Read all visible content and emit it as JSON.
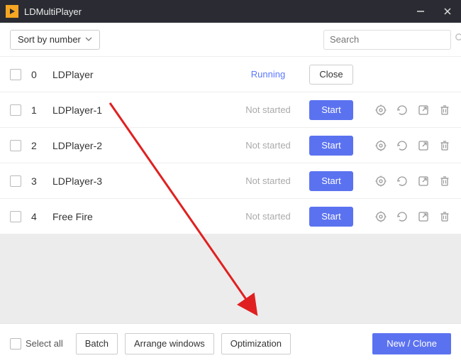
{
  "window": {
    "title": "LDMultiPlayer"
  },
  "toolbar": {
    "sort_label": "Sort by number",
    "search_placeholder": "Search"
  },
  "status_labels": {
    "running": "Running",
    "not_started": "Not started"
  },
  "action_labels": {
    "start": "Start",
    "close": "Close"
  },
  "instances": [
    {
      "index": "0",
      "name": "LDPlayer",
      "status": "running",
      "action": "close",
      "show_icons": false
    },
    {
      "index": "1",
      "name": "LDPlayer-1",
      "status": "not_started",
      "action": "start",
      "show_icons": true
    },
    {
      "index": "2",
      "name": "LDPlayer-2",
      "status": "not_started",
      "action": "start",
      "show_icons": true
    },
    {
      "index": "3",
      "name": "LDPlayer-3",
      "status": "not_started",
      "action": "start",
      "show_icons": true
    },
    {
      "index": "4",
      "name": "Free Fire",
      "status": "not_started",
      "action": "start",
      "show_icons": true
    }
  ],
  "footer": {
    "select_all": "Select all",
    "batch": "Batch",
    "arrange": "Arrange windows",
    "optimization": "Optimization",
    "new_clone": "New / Clone"
  },
  "colors": {
    "accent": "#5b72f0",
    "brand": "#f5a623"
  }
}
